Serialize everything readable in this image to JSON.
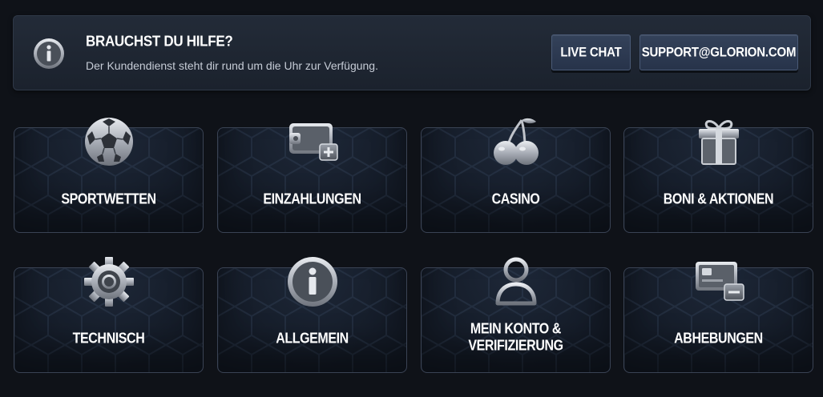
{
  "help": {
    "title": "BRAUCHST DU HILFE?",
    "subtitle": "Der Kundendienst steht dir rund um die Uhr zur Verfügung.",
    "live_chat_label": "LIVE CHAT",
    "email_label": "SUPPORT@GLORION.COM",
    "icon": "info-icon"
  },
  "categories": [
    {
      "label": "SPORTWETTEN",
      "icon": "soccer-ball-icon"
    },
    {
      "label": "EINZAHLUNGEN",
      "icon": "wallet-plus-icon"
    },
    {
      "label": "CASINO",
      "icon": "cherries-icon"
    },
    {
      "label": "BONI & AKTIONEN",
      "icon": "gift-icon"
    },
    {
      "label": "TECHNISCH",
      "icon": "gear-icon"
    },
    {
      "label": "ALLGEMEIN",
      "icon": "info-icon"
    },
    {
      "label_line1": "MEIN KONTO &",
      "label_line2": "VERIFIZIERUNG",
      "icon": "user-icon"
    },
    {
      "label": "ABHEBUNGEN",
      "icon": "card-minus-icon"
    }
  ],
  "colors": {
    "background": "#0f1218",
    "banner": "#1f2631",
    "button": "#2e3b52",
    "card": "#141b27",
    "icon_metal": "#b8bcc4"
  }
}
